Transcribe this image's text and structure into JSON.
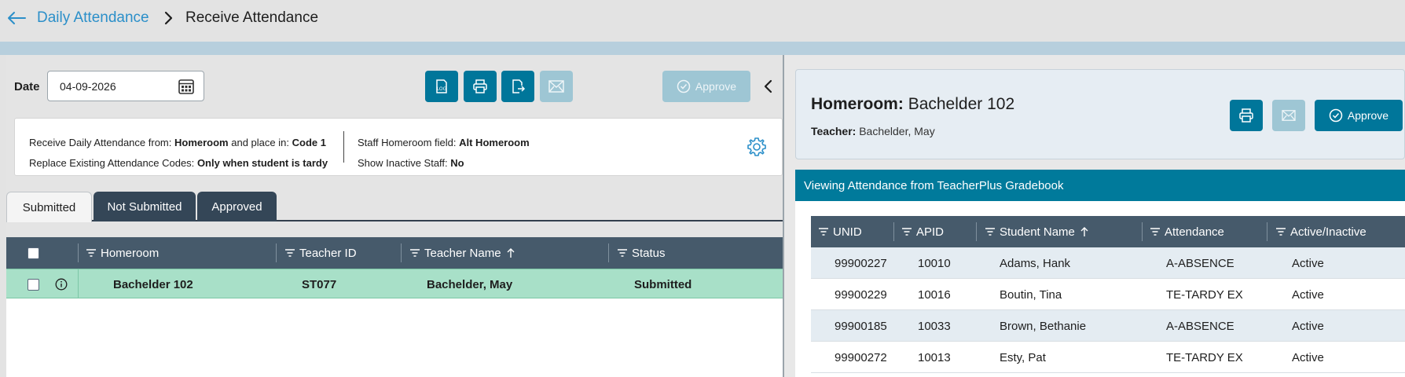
{
  "breadcrumb": {
    "parent": "Daily Attendance",
    "current": "Receive Attendance"
  },
  "toolbar": {
    "date_label": "Date",
    "date_value": "04-09-2026",
    "approve_label": "Approve"
  },
  "settings": {
    "receive_from_label": "Receive Daily Attendance from:",
    "receive_from_value": "Homeroom",
    "place_in_label": "and place in:",
    "place_in_value": "Code 1",
    "replace_label": "Replace Existing Attendance Codes:",
    "replace_value": "Only when student is tardy",
    "staff_field_label": "Staff Homeroom field:",
    "staff_field_value": "Alt Homeroom",
    "inactive_label": "Show Inactive Staff:",
    "inactive_value": "No"
  },
  "tabs": [
    {
      "label": "Submitted",
      "active": true
    },
    {
      "label": "Not Submitted",
      "active": false
    },
    {
      "label": "Approved",
      "active": false
    }
  ],
  "homeroom_grid": {
    "columns": [
      "Homeroom",
      "Teacher ID",
      "Teacher Name",
      "Status"
    ],
    "rows": [
      {
        "homeroom": "Bachelder 102",
        "teacher_id": "ST077",
        "teacher_name": "Bachelder, May",
        "status": "Submitted"
      }
    ]
  },
  "homeroom_card": {
    "title_label": "Homeroom:",
    "title_value": "Bachelder 102",
    "teacher_label": "Teacher:",
    "teacher_value": "Bachelder, May",
    "approve_label": "Approve"
  },
  "viewing_banner": "Viewing Attendance from TeacherPlus Gradebook",
  "attendance_grid": {
    "columns": [
      "UNID",
      "APID",
      "Student Name",
      "Attendance",
      "Active/Inactive"
    ],
    "rows": [
      {
        "unid": "99900227",
        "apid": "10010",
        "name": "Adams, Hank",
        "attendance": "A-ABSENCE",
        "active": "Active"
      },
      {
        "unid": "99900229",
        "apid": "10016",
        "name": "Boutin, Tina",
        "attendance": "TE-TARDY EX",
        "active": "Active"
      },
      {
        "unid": "99900185",
        "apid": "10033",
        "name": "Brown, Bethanie",
        "attendance": "A-ABSENCE",
        "active": "Active"
      },
      {
        "unid": "99900272",
        "apid": "10013",
        "name": "Esty, Pat",
        "attendance": "TE-TARDY EX",
        "active": "Active"
      }
    ]
  },
  "colors": {
    "primary": "#00769a",
    "grid_header": "#465a6b",
    "selected_row": "#a8e0c8",
    "link": "#2b8fc9"
  }
}
